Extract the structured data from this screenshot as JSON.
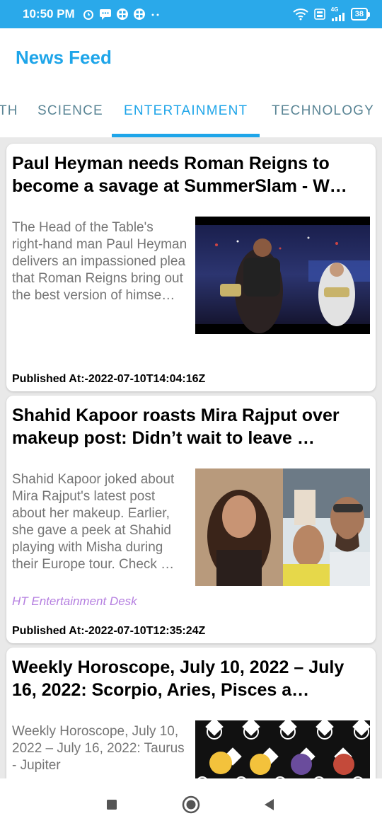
{
  "status_bar": {
    "time": "10:50 PM",
    "network": "4G",
    "battery": "38"
  },
  "app": {
    "title": "News Feed"
  },
  "tabs": [
    {
      "label": "TH"
    },
    {
      "label": "SCIENCE"
    },
    {
      "label": "ENTERTAINMENT",
      "active": true
    },
    {
      "label": "TECHNOLOGY"
    }
  ],
  "articles": [
    {
      "title": "Paul Heyman needs Roman Reigns to become a savage at SummerSlam - W…",
      "description": "The Head of the Table's right-hand man Paul Heyman delivers an impassioned plea that Roman Reigns bring out the best version of himse…",
      "author": "",
      "published": "Published At:-2022-07-10T14:04:16Z"
    },
    {
      "title": "Shahid Kapoor roasts Mira Rajput over makeup post: Didn’t wait to leave …",
      "description": "Shahid Kapoor joked about Mira Rajput's latest post about her makeup. Earlier, she gave a peek at Shahid playing with Misha during their Europe tour. Check …",
      "author": "HT Entertainment Desk",
      "published": "Published At:-2022-07-10T12:35:24Z"
    },
    {
      "title": "Weekly Horoscope, July 10, 2022 – July 16, 2022: Scorpio, Aries, Pisces a…",
      "description": "Weekly Horoscope, July 10, 2022 – July 16, 2022: Taurus - Jupiter",
      "author": "",
      "published": ""
    }
  ],
  "colors": {
    "accent": "#1ea5e9",
    "status_bar": "#2aa9ea",
    "author": "#b57fe0"
  }
}
